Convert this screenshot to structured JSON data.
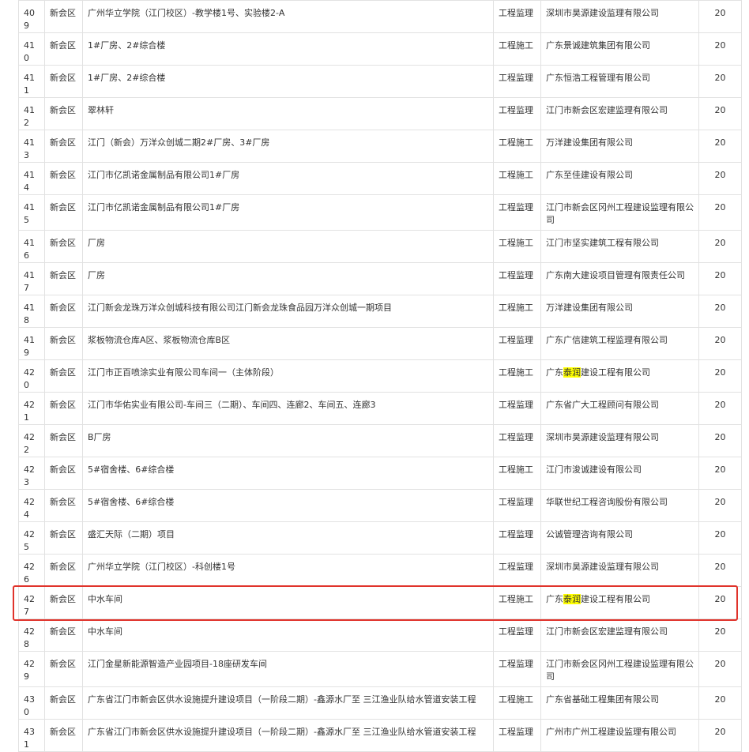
{
  "rows": [
    {
      "no": "409",
      "district": "新会区",
      "project": "广州华立学院（江门校区）-教学楼1号、实验楼2-A",
      "type": "工程监理",
      "company": "深圳市昊源建设监理有限公司",
      "score": "20",
      "h": 30
    },
    {
      "no": "410",
      "district": "新会区",
      "project": "1#厂房、2#综合楼",
      "type": "工程施工",
      "company": "广东景诚建筑集团有限公司",
      "score": "20",
      "h": 30
    },
    {
      "no": "411",
      "district": "新会区",
      "project": "1#厂房、2#综合楼",
      "type": "工程监理",
      "company": "广东恒浩工程管理有限公司",
      "score": "20",
      "h": 30
    },
    {
      "no": "412",
      "district": "新会区",
      "project": "翠林轩",
      "type": "工程监理",
      "company": "江门市新会区宏建监理有限公司",
      "score": "20",
      "h": 30
    },
    {
      "no": "413",
      "district": "新会区",
      "project": "江门（新会）万洋众创城二期2#厂房、3#厂房",
      "type": "工程施工",
      "company": "万洋建设集团有限公司",
      "score": "20",
      "h": 30
    },
    {
      "no": "414",
      "district": "新会区",
      "project": "江门市亿凯诺金属制品有限公司1#厂房",
      "type": "工程施工",
      "company": "广东至佳建设有限公司",
      "score": "20",
      "h": 30
    },
    {
      "no": "415",
      "district": "新会区",
      "project": "江门市亿凯诺金属制品有限公司1#厂房",
      "type": "工程监理",
      "company": "江门市新会区冈州工程建设监理有限公司",
      "score": "20",
      "h": 45
    },
    {
      "no": "416",
      "district": "新会区",
      "project": "厂房",
      "type": "工程施工",
      "company": "江门市坚实建筑工程有限公司",
      "score": "20",
      "h": 30
    },
    {
      "no": "417",
      "district": "新会区",
      "project": "厂房",
      "type": "工程监理",
      "company": "广东南大建设项目管理有限责任公司",
      "score": "20",
      "h": 30
    },
    {
      "no": "418",
      "district": "新会区",
      "project": "江门新会龙珠万洋众创城科技有限公司江门新会龙珠食品园万洋众创城一期项目",
      "type": "工程施工",
      "company": "万洋建设集团有限公司",
      "score": "20",
      "h": 30
    },
    {
      "no": "419",
      "district": "新会区",
      "project": "浆板物流仓库A区、浆板物流仓库B区",
      "type": "工程监理",
      "company": "广东广信建筑工程监理有限公司",
      "score": "20",
      "h": 30
    },
    {
      "no": "420",
      "district": "新会区",
      "project": "江门市正百喷涂实业有限公司车间一（主体阶段）",
      "type": "工程施工",
      "company": "建设工程有限公司",
      "company_pre": "广东",
      "company_hl": "泰润",
      "score": "20",
      "h": 30
    },
    {
      "no": "421",
      "district": "新会区",
      "project": "江门市华佑实业有限公司-车间三（二期）、车间四、连廊2、车间五、连廊3",
      "type": "工程监理",
      "company": "广东省广大工程顾问有限公司",
      "score": "20",
      "h": 30
    },
    {
      "no": "422",
      "district": "新会区",
      "project": "B厂房",
      "type": "工程监理",
      "company": "深圳市昊源建设监理有限公司",
      "score": "20",
      "h": 30
    },
    {
      "no": "423",
      "district": "新会区",
      "project": "5#宿舍楼、6#综合楼",
      "type": "工程施工",
      "company": "江门市浚诚建设有限公司",
      "score": "20",
      "h": 30
    },
    {
      "no": "424",
      "district": "新会区",
      "project": "5#宿舍楼、6#综合楼",
      "type": "工程监理",
      "company": "华联世纪工程咨询股份有限公司",
      "score": "20",
      "h": 30
    },
    {
      "no": "425",
      "district": "新会区",
      "project": "盛汇天际（二期）项目",
      "type": "工程监理",
      "company": "公诚管理咨询有限公司",
      "score": "20",
      "h": 30
    },
    {
      "no": "426",
      "district": "新会区",
      "project": "广州华立学院（江门校区）-科创楼1号",
      "type": "工程监理",
      "company": "深圳市昊源建设监理有限公司",
      "score": "20",
      "h": 30
    },
    {
      "no": "427",
      "district": "新会区",
      "project": "中水车间",
      "type": "工程施工",
      "company": "建设工程有限公司",
      "company_pre": "广东",
      "company_hl": "泰润",
      "score": "20",
      "h": 30
    },
    {
      "no": "428",
      "district": "新会区",
      "project": "中水车间",
      "type": "工程监理",
      "company": "江门市新会区宏建监理有限公司",
      "score": "20",
      "h": 30
    },
    {
      "no": "429",
      "district": "新会区",
      "project": "江门金星新能源智造产业园项目-18座研发车间",
      "type": "工程监理",
      "company": "江门市新会区冈州工程建设监理有限公司",
      "score": "20",
      "h": 45
    },
    {
      "no": "430",
      "district": "新会区",
      "project": "广东省江门市新会区供水设施提升建设项目（一阶段二期）-鑫源水厂至 三江渔业队给水管道安装工程",
      "type": "工程施工",
      "company": "广东省基础工程集团有限公司",
      "score": "20",
      "h": 30
    },
    {
      "no": "431",
      "district": "新会区",
      "project": "广东省江门市新会区供水设施提升建设项目（一阶段二期）-鑫源水厂至 三江渔业队给水管道安装工程",
      "type": "工程监理",
      "company": "广州市广州工程建设监理有限公司",
      "score": "20",
      "h": 30
    }
  ],
  "highlighted_row_no": "427",
  "colors": {
    "border": "#e2e2e2",
    "marker": "#e0332b",
    "highlight": "#ffff00",
    "text": "#333333"
  }
}
